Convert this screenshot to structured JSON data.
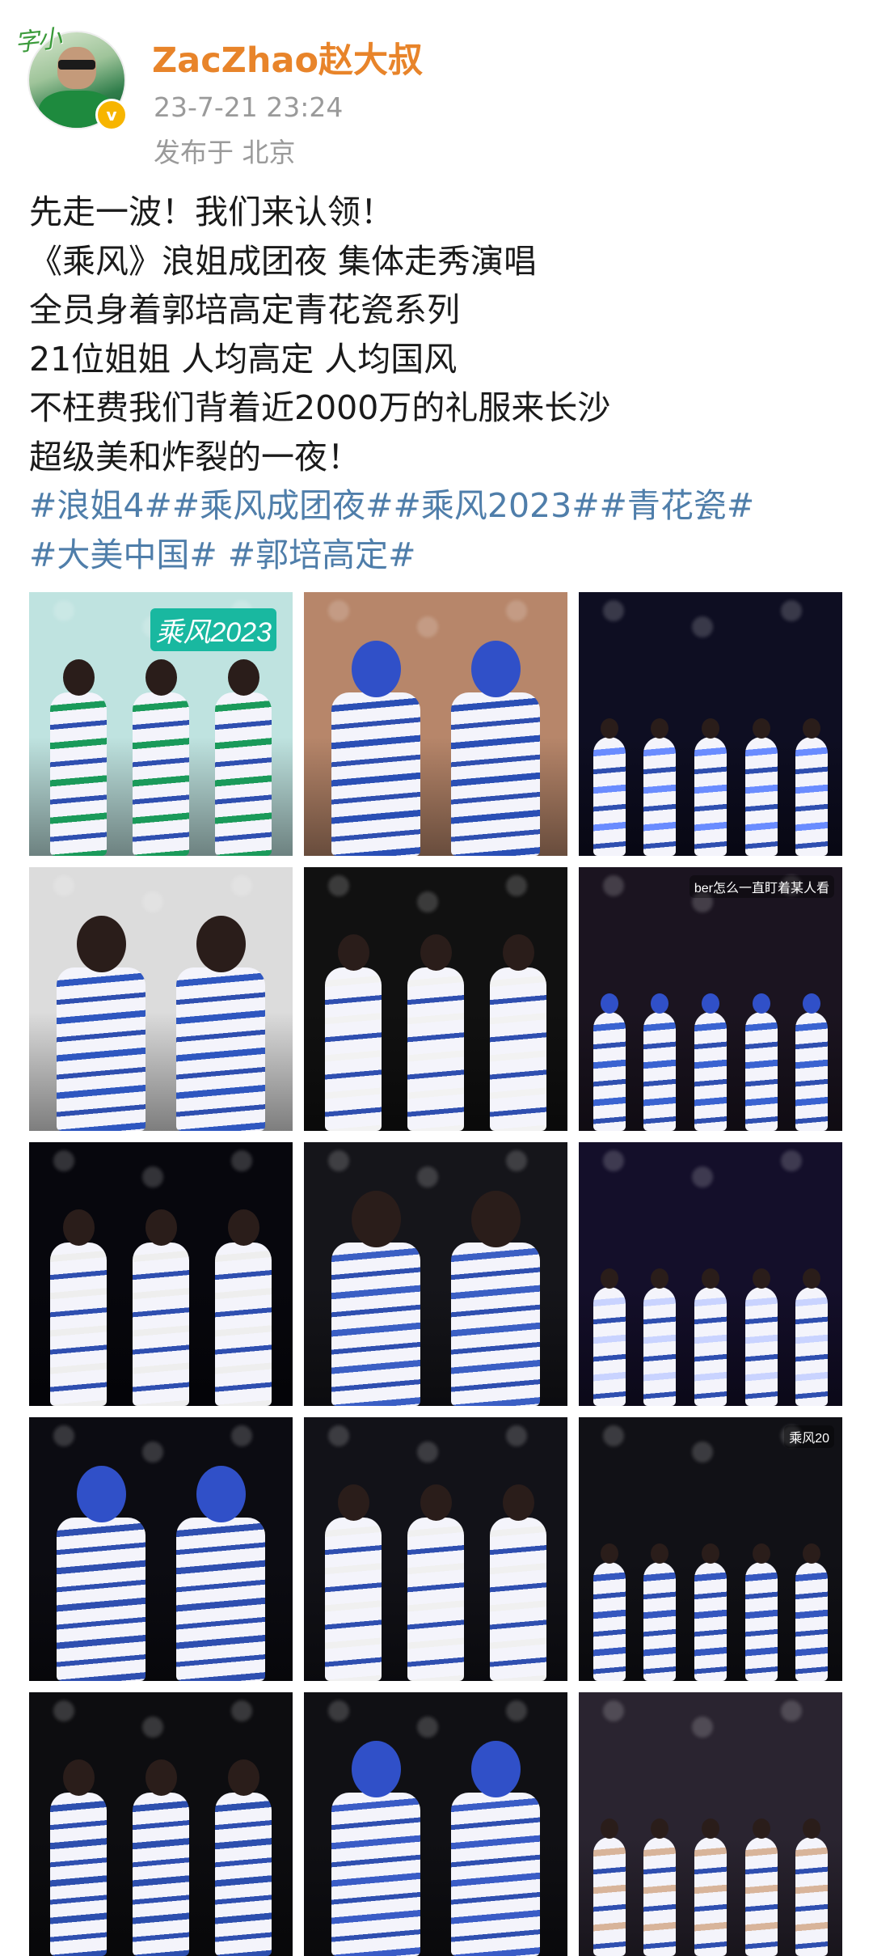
{
  "post": {
    "author": "ZacZhao赵大叔",
    "avatar_badge": "字小",
    "verified_icon": "verified-badge-icon",
    "time": "23-7-21 23:24",
    "location": "发布于 北京"
  },
  "body_lines": [
    "先走一波！我们来认领！",
    "《乘风》浪姐成团夜 集体走秀演唱",
    "全员身着郭培高定青花瓷系列",
    "21位姐姐 人均高定  人均国风",
    "不枉费我们背着近2000万的礼服来长沙",
    "超级美和炸裂的一夜！"
  ],
  "hashtag_lines": [
    "#浪姐4##乘风成团夜##乘风2023##青花瓷#",
    "#大美中国# #郭培高定#"
  ],
  "photos": [
    {
      "name": "group-photo-stage",
      "caption": "乘风2023",
      "bg": "#bfe3e0",
      "accent": "#1a9a5a"
    },
    {
      "name": "group-photo-seated",
      "caption": "",
      "bg": "#b7866a",
      "accent": "#2a4fb5"
    },
    {
      "name": "stage-lineup-photo",
      "caption": "",
      "bg": "#0e0e22",
      "accent": "#6a8cff"
    },
    {
      "name": "closeup-portrait-photo",
      "caption": "",
      "bg": "#dcdcdc",
      "accent": "#2f57c0"
    },
    {
      "name": "duet-singing-photo",
      "caption": "",
      "bg": "#111111",
      "accent": "#f2f2f2"
    },
    {
      "name": "performance-photo",
      "caption": "ber怎么一直盯着某人看",
      "bg": "#1b1420",
      "accent": "#3a63d1"
    },
    {
      "name": "duo-on-stage-photo",
      "caption": "",
      "bg": "#07070d",
      "accent": "#eeeeee"
    },
    {
      "name": "duet-closeup-photo",
      "caption": "",
      "bg": "#15151a",
      "accent": "#3b5fc4"
    },
    {
      "name": "stage-wide-photo",
      "caption": "",
      "bg": "#140f2a",
      "accent": "#c9d3ff"
    },
    {
      "name": "trio-stage-photo",
      "caption": "",
      "bg": "#0c0c12",
      "accent": "#2f4fb0"
    },
    {
      "name": "duet-white-outfits-photo",
      "caption": "",
      "bg": "#121218",
      "accent": "#f0f0f0"
    },
    {
      "name": "singing-closeup-photo",
      "caption": "乘风20",
      "bg": "#111116",
      "accent": "#3557bf"
    },
    {
      "name": "two-singers-photo",
      "caption": "",
      "bg": "#0d0d10",
      "accent": "#2d4fae"
    },
    {
      "name": "pair-walking-photo",
      "caption": "",
      "bg": "#101014",
      "accent": "#3a5cc6"
    },
    {
      "name": "group-selfie-photo",
      "caption": "",
      "bg": "#2a2430",
      "accent": "#d8b49a"
    }
  ]
}
